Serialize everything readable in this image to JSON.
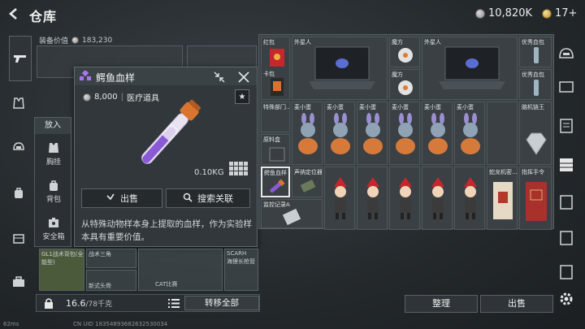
{
  "header": {
    "title": "仓库",
    "silver_amount": "10,820K",
    "gold_amount": "17+"
  },
  "equip": {
    "value_label": "装备价值",
    "value_amount": "183,230"
  },
  "popup": {
    "item_name": "鳄鱼血样",
    "price": "8,000",
    "category": "医疗道具",
    "weight": "0.10KG",
    "sell_label": "出售",
    "search_related_label": "搜索关联",
    "description": "从特殊动物样本身上提取的血样，作为实验样本具有重要价值。"
  },
  "putin_menu": {
    "title": "放入",
    "items": [
      {
        "label": "胸挂",
        "icon": "vest-icon"
      },
      {
        "label": "背包",
        "icon": "backpack-icon"
      },
      {
        "label": "安全箱",
        "icon": "safebox-icon"
      }
    ]
  },
  "backpack": {
    "items": [
      {
        "label": "GL1战术背包(全能型)"
      },
      {
        "label": "战术三角"
      },
      {
        "label": "新式头骨"
      },
      {
        "label": "CAT比赛"
      },
      {
        "label": "SCARH"
      },
      {
        "label": "海狸长枪管"
      }
    ],
    "weight_current": "16.6",
    "weight_max": "/78千克",
    "transfer_all_label": "转移全部",
    "uid": "CN UID 18354893682632530034",
    "ping": "62ms"
  },
  "warehouse": {
    "items": {
      "red_envelope": "红包",
      "laptop_1": "外星人",
      "cube_1": "魔方",
      "laptop_2": "外星人",
      "vial_1": "优秀血包",
      "card": "卡包",
      "cube_2": "魔方",
      "vial_2": "优秀血包",
      "special_ops": "特殊部门...",
      "mc_1": "麦小蛋",
      "mc_2": "麦小蛋",
      "mc_3": "麦小蛋",
      "mc_4": "麦小蛋",
      "mc_5": "麦小蛋",
      "mc_6": "麦小蛋",
      "mech_king": "脑机链王",
      "raw_ore": "原料盒",
      "croc_blood": "鳄鱼血样",
      "sound_locator": "声纳定位器",
      "dragon_doc": "蛇龙机密...",
      "guide": "指挥手令",
      "monitor_log": "监控记录A"
    }
  },
  "bottom_actions": {
    "organize_label": "整理",
    "sell_label": "出售"
  },
  "colors": {
    "accent_orange": "#d9752f",
    "vial_purple": "#8a5ad6",
    "panel_bg": "#31373b"
  }
}
